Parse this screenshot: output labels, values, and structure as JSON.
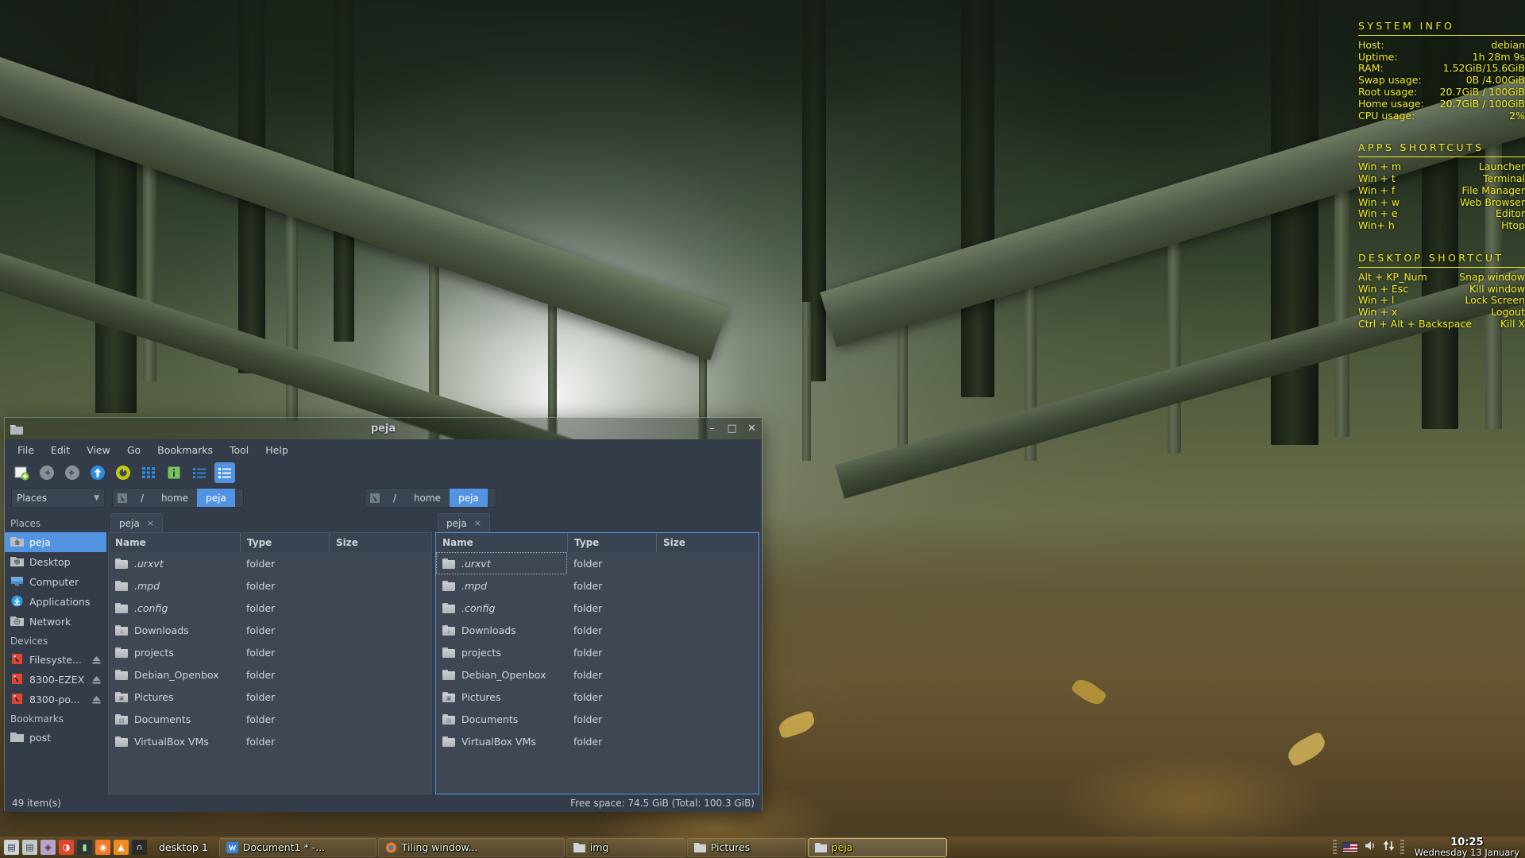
{
  "conky": {
    "system_info_heading": "SYSTEM INFO",
    "system_rows": [
      {
        "label": "Host:",
        "value": "debian"
      },
      {
        "label": "Uptime:",
        "value": "1h 28m 9s"
      },
      {
        "label": "RAM:",
        "value": "1.52GiB/15.6GiB"
      },
      {
        "label": "Swap usage:",
        "value": "0B  /4.00GiB"
      },
      {
        "label": "Root usage:",
        "value": "20.7GiB / 100GiB"
      },
      {
        "label": "Home usage:",
        "value": "20.7GiB / 100GiB"
      },
      {
        "label": "CPU usage:",
        "value": "2%"
      }
    ],
    "apps_shortcuts_heading": "APPS SHORTCUTS",
    "apps_rows": [
      {
        "label": "Win + m",
        "value": "Launcher"
      },
      {
        "label": "Win + t",
        "value": "Terminal"
      },
      {
        "label": "Win + f",
        "value": "File Manager"
      },
      {
        "label": "Win + w",
        "value": "Web Browser"
      },
      {
        "label": "Win + e",
        "value": "Editor"
      },
      {
        "label": "Win+ h",
        "value": "Htop"
      }
    ],
    "desktop_shortcuts_heading": "DESKTOP SHORTCUT",
    "desktop_rows": [
      {
        "label": "Alt + KP_Num",
        "value": "Snap window"
      },
      {
        "label": "Win + Esc",
        "value": "Kill window"
      },
      {
        "label": "Win + l",
        "value": "Lock Screen"
      },
      {
        "label": "Win + x",
        "value": "Logout"
      },
      {
        "label": "Ctrl + Alt + Backspace",
        "value": "Kill X"
      }
    ],
    "accent_color": "#f2ec20"
  },
  "window": {
    "title": "peja",
    "minimize_label": "–",
    "maximize_label": "□",
    "close_label": "✕"
  },
  "menubar": [
    {
      "label": "File"
    },
    {
      "label": "Edit"
    },
    {
      "label": "View"
    },
    {
      "label": "Go"
    },
    {
      "label": "Bookmarks"
    },
    {
      "label": "Tool"
    },
    {
      "label": "Help"
    }
  ],
  "toolbar": [
    {
      "name": "new-tab-icon",
      "tooltip": "New Tab"
    },
    {
      "name": "back-icon",
      "tooltip": "Back"
    },
    {
      "name": "forward-icon",
      "tooltip": "Forward"
    },
    {
      "name": "up-icon",
      "tooltip": "Go Up"
    },
    {
      "name": "reload-icon",
      "tooltip": "Reload"
    },
    {
      "name": "grid-view-icon",
      "tooltip": "Icon View"
    },
    {
      "name": "info-icon",
      "tooltip": "Show Info"
    },
    {
      "name": "compact-list-icon",
      "tooltip": "Compact View"
    },
    {
      "name": "detailed-list-icon",
      "tooltip": "Detailed List View"
    }
  ],
  "places_combo": {
    "value": "Places",
    "chevron": "▼"
  },
  "breadcrumb": {
    "root": "/",
    "home": "home",
    "current": "peja"
  },
  "sidebar": {
    "group_places": "Places",
    "places": [
      {
        "label": "peja",
        "icon": "home-folder-icon",
        "selected": true
      },
      {
        "label": "Desktop",
        "icon": "desktop-folder-icon",
        "selected": false
      },
      {
        "label": "Computer",
        "icon": "computer-icon",
        "selected": false
      },
      {
        "label": "Applications",
        "icon": "applications-icon",
        "selected": false
      },
      {
        "label": "Network",
        "icon": "network-folder-icon",
        "selected": false
      }
    ],
    "group_devices": "Devices",
    "devices": [
      {
        "label": "Filesyste...",
        "icon": "drive-icon",
        "eject": true
      },
      {
        "label": "8300-EZEX",
        "icon": "drive-icon",
        "eject": true
      },
      {
        "label": "8300-po...",
        "icon": "drive-icon",
        "eject": true
      }
    ],
    "group_bookmarks": "Bookmarks",
    "bookmarks": [
      {
        "label": "post",
        "icon": "folder-icon"
      }
    ]
  },
  "tabs": {
    "left_label": "peja",
    "right_label": "peja",
    "close_glyph": "×"
  },
  "columns": {
    "name": "Name",
    "type": "Type",
    "size": "Size"
  },
  "files": [
    {
      "name": ".urxvt",
      "type": "folder",
      "size": "",
      "hidden": true,
      "icon": "folder-icon"
    },
    {
      "name": ".mpd",
      "type": "folder",
      "size": "",
      "hidden": true,
      "icon": "folder-icon"
    },
    {
      "name": ".config",
      "type": "folder",
      "size": "",
      "hidden": true,
      "icon": "folder-icon"
    },
    {
      "name": "Downloads",
      "type": "folder",
      "size": "",
      "hidden": false,
      "icon": "downloads-folder-icon"
    },
    {
      "name": "projects",
      "type": "folder",
      "size": "",
      "hidden": false,
      "icon": "folder-icon"
    },
    {
      "name": "Debian_Openbox",
      "type": "folder",
      "size": "",
      "hidden": false,
      "icon": "folder-icon"
    },
    {
      "name": "Pictures",
      "type": "folder",
      "size": "",
      "hidden": false,
      "icon": "pictures-folder-icon"
    },
    {
      "name": "Documents",
      "type": "folder",
      "size": "",
      "hidden": false,
      "icon": "documents-folder-icon"
    },
    {
      "name": "VirtualBox VMs",
      "type": "folder",
      "size": "",
      "hidden": false,
      "icon": "folder-icon"
    }
  ],
  "statusbar": {
    "item_count": "49 item(s)",
    "free_space": "Free space: 74.5 GiB (Total: 100.3 GiB)"
  },
  "taskbar": {
    "tray": [
      {
        "name": "text-editor-icon"
      },
      {
        "name": "file-manager-icon"
      },
      {
        "name": "software-icon"
      },
      {
        "name": "media-player-icon"
      },
      {
        "name": "terminal-icon"
      },
      {
        "name": "firefox-icon"
      },
      {
        "name": "vlc-icon"
      },
      {
        "name": "headphones-icon"
      }
    ],
    "desktop_label": "desktop 1",
    "tasks": [
      {
        "label": "Document1 * -...",
        "icon": "writer-icon",
        "active": false
      },
      {
        "label": "Tiling window...",
        "icon": "firefox-icon",
        "active": false
      },
      {
        "label": "img",
        "icon": "folder-icon",
        "active": false
      },
      {
        "label": "Pictures",
        "icon": "folder-icon",
        "active": false
      },
      {
        "label": "peja",
        "icon": "folder-icon",
        "active": true
      }
    ],
    "keyboard_layout": "us-flag-icon",
    "volume": "volume-icon",
    "network": "network-updown-icon",
    "clock_time": "10:25",
    "clock_date": "Wednesday 13 January"
  }
}
